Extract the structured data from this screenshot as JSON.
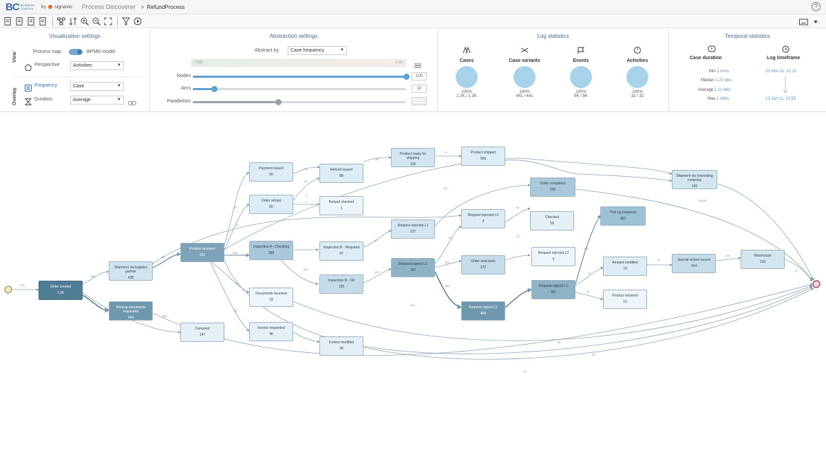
{
  "app": {
    "logo_text": "BC",
    "logo_subtext": "BUSINESS CONTROL",
    "logo_by": "by",
    "logo_partner": "signavio",
    "breadcrumb_app": "Process Discoverer",
    "breadcrumb_separator": ">",
    "breadcrumb_page": "RefundProcess"
  },
  "visualization": {
    "title": "Visualization settings",
    "view_label": "View",
    "overlay_label": "Overlay",
    "process_map_label": "Process map",
    "bpmn_label": "BPMN model",
    "perspective_label": "Perspective",
    "perspective_value": "Activities",
    "frequency_label": "Frequency",
    "frequency_value": "Case",
    "duration_label": "Duration",
    "duration_value": "Average"
  },
  "abstraction": {
    "title": "Abstraction settings",
    "abstract_by_label": "Abstract by",
    "abstract_by_value": "Case frequency",
    "high_label": "High",
    "low_label": "Low",
    "nodes_label": "Nodes",
    "nodes_value": "100",
    "nodes_fraction": 1.0,
    "arcs_label": "Arcs",
    "arcs_value": "10",
    "arcs_fraction": 0.1,
    "parallelism_label": "Parallelism",
    "parallelism_value": "",
    "parallelism_fraction": 0.4
  },
  "log_statistics": {
    "title": "Log statistics",
    "items": [
      {
        "title": "Cases",
        "pct": "100%",
        "value": "1.3K / 1.3K"
      },
      {
        "title": "Case variants",
        "pct": "100%",
        "value": "441 / 441"
      },
      {
        "title": "Events",
        "pct": "100%",
        "value": "9K / 9K"
      },
      {
        "title": "Activities",
        "pct": "100%",
        "value": "32 / 32"
      }
    ]
  },
  "temporal_statistics": {
    "title": "Temporal statistics",
    "case_duration_title": "Case duration",
    "log_timeframe_title": "Log timeframe",
    "rows": [
      {
        "label": "Min",
        "value": "2 mins"
      },
      {
        "label": "Median",
        "value": "1.25 wks"
      },
      {
        "label": "Average",
        "value": "1.11 wks"
      },
      {
        "label": "Max",
        "value": "1 mths"
      }
    ],
    "start": "23 Nov 11, 12:12",
    "end": "13 Jan 11, 10:53"
  },
  "process_map": {
    "start_count": "1.3K",
    "end_count": "46.4",
    "nodes": [
      {
        "id": "n1",
        "label": "Order created",
        "count": "1.3K"
      },
      {
        "id": "n2",
        "label": "Shipment via logistics partner",
        "count": "438"
      },
      {
        "id": "n3",
        "label": "Missing documents requested",
        "count": "464"
      },
      {
        "id": "n4",
        "label": "Canceled",
        "count": "147"
      },
      {
        "id": "n5",
        "label": "Product received",
        "count": "601"
      },
      {
        "id": "n6",
        "label": "Payment issued",
        "count": "90"
      },
      {
        "id": "n7",
        "label": "Order refund",
        "count": "60"
      },
      {
        "id": "n8",
        "label": "Refund issued",
        "count": "88"
      },
      {
        "id": "n9",
        "label": "Refund checked",
        "count": "1"
      },
      {
        "id": "n10",
        "label": "Inspection A - Checking",
        "count": "288"
      },
      {
        "id": "n11",
        "label": "Inspection B - Required",
        "count": "97"
      },
      {
        "id": "n12",
        "label": "Inspection B - OK",
        "count": "195"
      },
      {
        "id": "n13",
        "label": "Documents received",
        "count": "18"
      },
      {
        "id": "n14",
        "label": "Invoice requested",
        "count": "46"
      },
      {
        "id": "n15",
        "label": "Invoice modified",
        "count": "28"
      },
      {
        "id": "n16",
        "label": "Product ready for shipping",
        "count": "125"
      },
      {
        "id": "n17",
        "label": "Product shipped",
        "count": "566"
      },
      {
        "id": "n18",
        "label": "Request rejected L1",
        "count": "237"
      },
      {
        "id": "n19",
        "label": "Request rejected L2",
        "count": "9"
      },
      {
        "id": "n20",
        "label": "Request signed L1",
        "count": "767"
      },
      {
        "id": "n21",
        "label": "Order sent back",
        "count": "272"
      },
      {
        "id": "n22",
        "label": "Request signed L2",
        "count": "466"
      },
      {
        "id": "n23",
        "label": "Order completed",
        "count": "256"
      },
      {
        "id": "n24",
        "label": "Checked",
        "count": "58"
      },
      {
        "id": "n25",
        "label": "Request rejected L3",
        "count": "4"
      },
      {
        "id": "n26",
        "label": "Request signed L3",
        "count": "357"
      },
      {
        "id": "n27",
        "label": "Pick up prepared",
        "count": "383"
      },
      {
        "id": "n28",
        "label": "Shipment via forwarding company",
        "count": "166"
      },
      {
        "id": "n29",
        "label": "Amount modified",
        "count": "79"
      },
      {
        "id": "n30",
        "label": "Product returned",
        "count": "12"
      },
      {
        "id": "n31",
        "label": "Special refund issued",
        "count": "314"
      },
      {
        "id": "n32",
        "label": "Warehouse",
        "count": "133"
      }
    ],
    "edges": [
      {
        "id": "e1",
        "label": "1.3K"
      },
      {
        "id": "e2",
        "label": "866"
      },
      {
        "id": "e3",
        "label": "554"
      },
      {
        "id": "e4",
        "label": "1K"
      },
      {
        "id": "e5",
        "label": "80"
      },
      {
        "id": "e6",
        "label": "73"
      },
      {
        "id": "e7",
        "label": "288"
      },
      {
        "id": "e8",
        "label": "195"
      },
      {
        "id": "e9",
        "label": "18"
      },
      {
        "id": "e10",
        "label": "46"
      },
      {
        "id": "e11",
        "label": "63"
      },
      {
        "id": "e12",
        "label": "44"
      },
      {
        "id": "e13",
        "label": "1"
      },
      {
        "id": "e14",
        "label": "1"
      },
      {
        "id": "e15",
        "label": "107"
      },
      {
        "id": "e16",
        "label": "74"
      },
      {
        "id": "e17",
        "label": "425"
      },
      {
        "id": "e18",
        "label": "97"
      },
      {
        "id": "e19",
        "label": "220"
      },
      {
        "id": "e20",
        "label": "380"
      },
      {
        "id": "e21",
        "label": "53"
      },
      {
        "id": "e22",
        "label": "61"
      },
      {
        "id": "e23",
        "label": "21"
      },
      {
        "id": "e24",
        "label": "180"
      },
      {
        "id": "e25",
        "label": "79"
      },
      {
        "id": "e26",
        "label": "73"
      },
      {
        "id": "e27",
        "label": "12"
      },
      {
        "id": "e28",
        "label": "116"
      },
      {
        "id": "e29",
        "label": "130"
      },
      {
        "id": "e30",
        "label": "464"
      },
      {
        "id": "e31",
        "label": "127"
      },
      {
        "id": "e32",
        "label": "95"
      },
      {
        "id": "e33",
        "label": "38"
      },
      {
        "id": "e34",
        "label": "24"
      },
      {
        "id": "e35",
        "label": "100"
      },
      {
        "id": "e36",
        "label": "6"
      },
      {
        "id": "e37",
        "label": "118"
      }
    ]
  },
  "colors": {
    "accent": "#3b6ea5",
    "node_light": "#ddedf6",
    "node_mid": "#b7d4e4",
    "node_dark": "#5e8ea8",
    "node_darkest": "#3f6a80"
  }
}
